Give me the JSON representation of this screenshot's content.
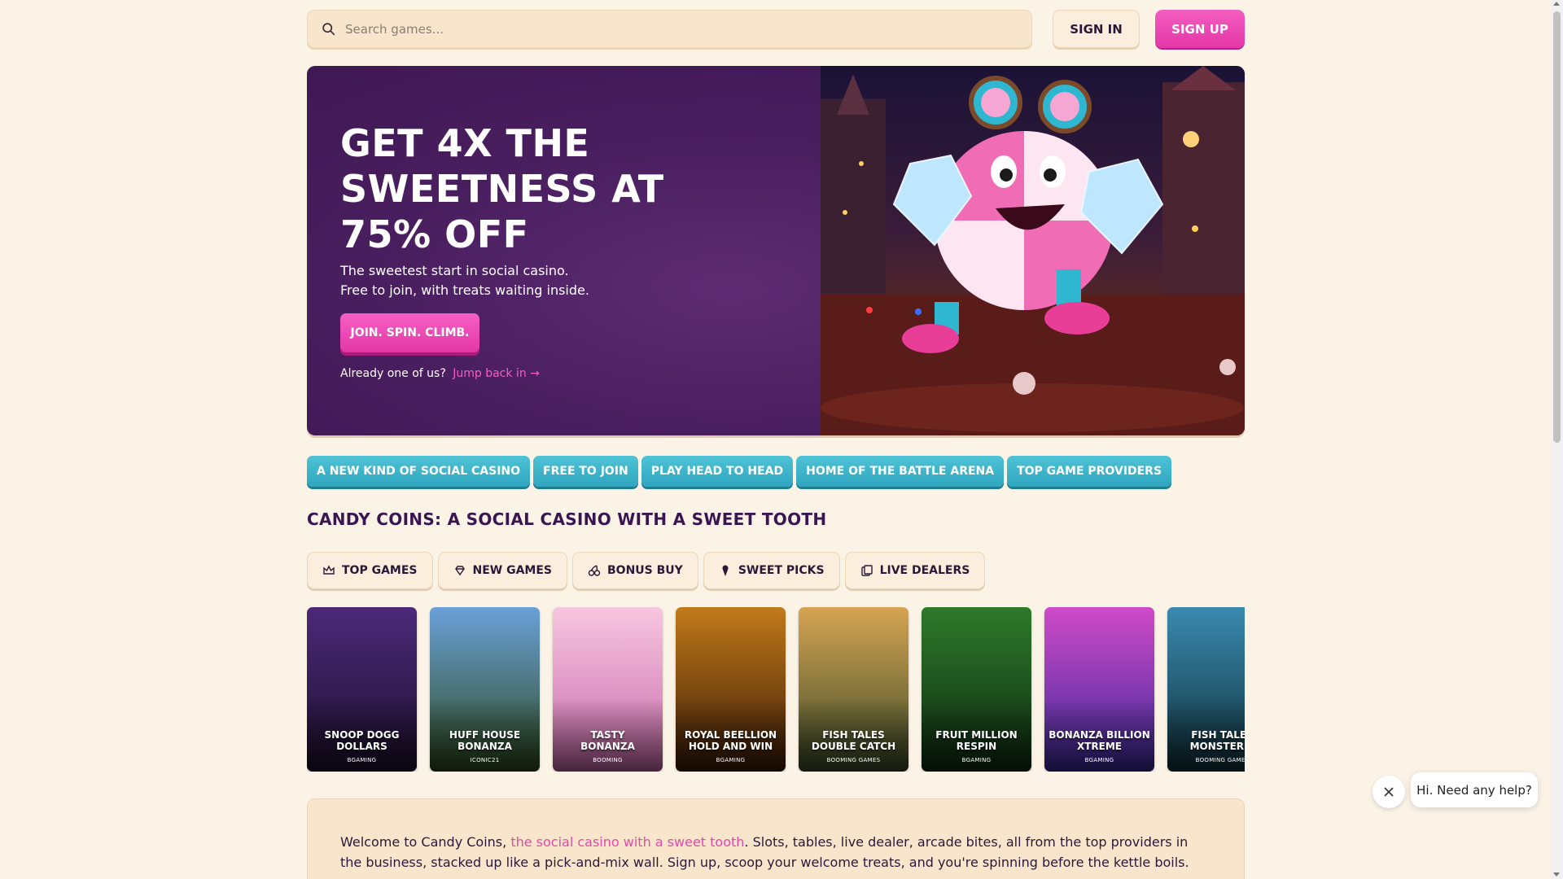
{
  "header": {
    "search_placeholder": "Search games...",
    "sign_in": "SIGN IN",
    "sign_up": "SIGN UP"
  },
  "hero": {
    "title": "GET 4X THE SWEETNESS AT 75% OFF",
    "subtitle_line1": "The sweetest start in social casino.",
    "subtitle_line2": "Free to join, with treats waiting inside.",
    "cta": "JOIN. SPIN. CLIMB.",
    "login_prompt": "Already one of us?",
    "login_link": "Jump back in →"
  },
  "feature_pills": [
    "A NEW KIND OF SOCIAL CASINO",
    "FREE TO JOIN",
    "PLAY HEAD TO HEAD",
    "HOME OF THE BATTLE ARENA",
    "TOP GAME PROVIDERS"
  ],
  "section_title": "CANDY COINS: A SOCIAL CASINO WITH A SWEET TOOTH",
  "tabs": [
    {
      "label": "TOP GAMES",
      "icon": "crown-icon"
    },
    {
      "label": "NEW GAMES",
      "icon": "gem-icon"
    },
    {
      "label": "BONUS BUY",
      "icon": "cherries-icon"
    },
    {
      "label": "SWEET PICKS",
      "icon": "ice-cream-icon"
    },
    {
      "label": "LIVE DEALERS",
      "icon": "cards-icon"
    }
  ],
  "games": [
    {
      "name": "SNOOP DOGG\nDOLLARS",
      "provider": "BGAMING",
      "colors": [
        "#4b2a7a",
        "#1c0f2c"
      ]
    },
    {
      "name": "HUFF HOUSE\nBONANZA",
      "provider": "ICONIC21",
      "colors": [
        "#6aa0d8",
        "#2d4a1d"
      ]
    },
    {
      "name": "TASTY\nBONANZA",
      "provider": "BOOMING",
      "colors": [
        "#f7c6e0",
        "#c76aa9"
      ]
    },
    {
      "name": "ROYAL BEELLION\nHOLD AND WIN",
      "provider": "BGAMING",
      "colors": [
        "#c27a1a",
        "#3a1a06"
      ]
    },
    {
      "name": "FISH TALES\nDOUBLE CATCH",
      "provider": "BOOMING GAMES",
      "colors": [
        "#d6a452",
        "#3a4a28"
      ]
    },
    {
      "name": "FRUIT MILLION\nRESPIN",
      "provider": "BGAMING",
      "colors": [
        "#2e7a2a",
        "#0e2a12"
      ]
    },
    {
      "name": "BONANZA BILLION\nXTREME",
      "provider": "BGAMING",
      "colors": [
        "#d04ac8",
        "#3a2a9a"
      ]
    },
    {
      "name": "FISH TALES\nMONSTER R",
      "provider": "BOOMING GAMES",
      "colors": [
        "#3a8ab0",
        "#10303a"
      ]
    }
  ],
  "welcome": {
    "before": "Welcome to Candy Coins, ",
    "highlight": "the social casino with a sweet tooth",
    "after": ". Slots, tables, live dealer, arcade bites, all from the top providers in the business, stacked up like a pick-and-mix wall. Sign up, scoop your welcome treats, and you're spinning before the kettle boils."
  },
  "chat": {
    "message": "Hi. Need any help?"
  },
  "colors": {
    "background": "#fbf3e6",
    "brand_pink": "#e436a8",
    "pill_teal": "#2ea6bf",
    "hero_purple": "#4a1f60"
  }
}
